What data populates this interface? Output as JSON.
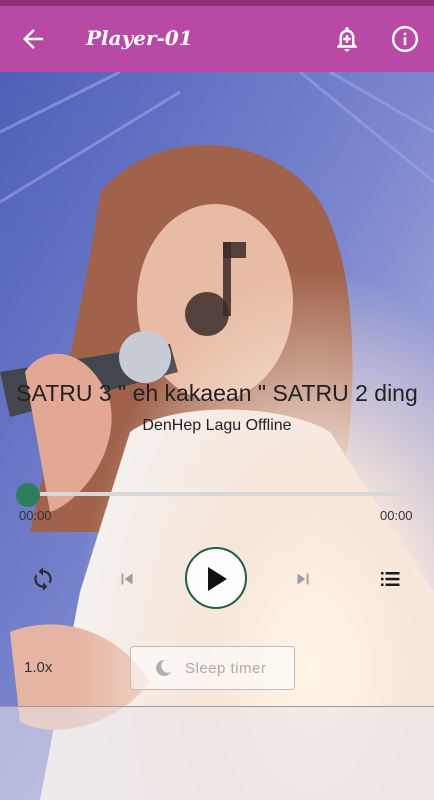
{
  "appbar": {
    "title": "Player-01"
  },
  "song": {
    "title": "SATRU 3 \" eh kakaean \" SATRU 2 ding",
    "artist": "DenHep Lagu Offline"
  },
  "seek": {
    "elapsed": "00:00",
    "duration": "00:00",
    "progress": 0
  },
  "controls": {
    "speed": "1.0x",
    "sleep_timer": "Sleep timer"
  },
  "colors": {
    "appbar": "#b84aa5",
    "accent": "#2e7d5b"
  },
  "icons": [
    "back-arrow-icon",
    "add-alarm-icon",
    "info-icon",
    "music-note-icon",
    "repeat-icon",
    "skip-previous-icon",
    "play-icon",
    "skip-next-icon",
    "playlist-icon",
    "moon-icon"
  ]
}
